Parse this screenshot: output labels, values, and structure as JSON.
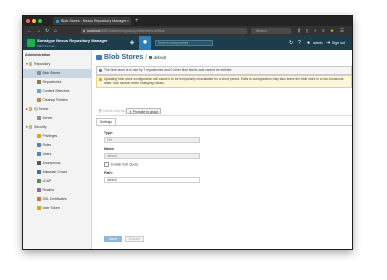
{
  "browser": {
    "tab_title": "Blob Stores - Nexus Repository Manager",
    "url_host": "localhost",
    "url_path": ":8081/#admin/repository/blobstores:default",
    "search_placeholder": "Search"
  },
  "header": {
    "app_title": "Sonatype Nexus Repository Manager",
    "version": "PRO 3.x.x-xx",
    "search_placeholder": "Search components",
    "user": "admin",
    "signout_label": "Sign out"
  },
  "sidebar": {
    "title": "Administration",
    "items": [
      {
        "label": "Repository",
        "icon": "folder-icon"
      },
      {
        "label": "Blob Stores",
        "icon": "database-icon"
      },
      {
        "label": "Repositories",
        "icon": "box-icon"
      },
      {
        "label": "Content Selectors",
        "icon": "selector-icon"
      },
      {
        "label": "Cleanup Policies",
        "icon": "broom-icon"
      },
      {
        "label": "IQ Server",
        "icon": "folder-icon"
      },
      {
        "label": "Server",
        "icon": "server-icon"
      },
      {
        "label": "Security",
        "icon": "folder-icon"
      },
      {
        "label": "Privileges",
        "icon": "key-icon"
      },
      {
        "label": "Roles",
        "icon": "roles-icon"
      },
      {
        "label": "Users",
        "icon": "users-icon"
      },
      {
        "label": "Anonymous",
        "icon": "anonymous-icon"
      },
      {
        "label": "Atlassian Crowd",
        "icon": "crowd-icon"
      },
      {
        "label": "LDAP",
        "icon": "ldap-icon"
      },
      {
        "label": "Realms",
        "icon": "realms-icon"
      },
      {
        "label": "SSL Certificates",
        "icon": "certificate-icon"
      },
      {
        "label": "User Token",
        "icon": "token-icon"
      }
    ]
  },
  "page": {
    "title": "Blob Stores",
    "separator": "/",
    "subtitle": "default",
    "info_banner": "The blob store is in use by 7 repositories and 0 other blob stores and cannot be deleted",
    "warning_banner": "Updating blob store configuration will cause it to be temporarily unavailable for a short period. Edits to configuration may also leave the blob store in a non-functional state. Use caution when changing values.",
    "actions": {
      "delete_label": "Delete blob store",
      "promote_label": "Promote to group"
    },
    "tab_label": "Settings"
  },
  "form": {
    "type_label": "Type:",
    "type_value": "File",
    "name_label": "Name:",
    "name_value": "default",
    "soft_quota_label": "Enable Soft Quota",
    "path_label": "Path:",
    "path_value": "default",
    "save_label": "Save",
    "discard_label": "Discard"
  },
  "colors": {
    "header_bg": "#1d3d4c",
    "accent": "#2e7fb8",
    "selected_row": "#c9d7e3",
    "warning_bg": "#fdf7dd"
  }
}
